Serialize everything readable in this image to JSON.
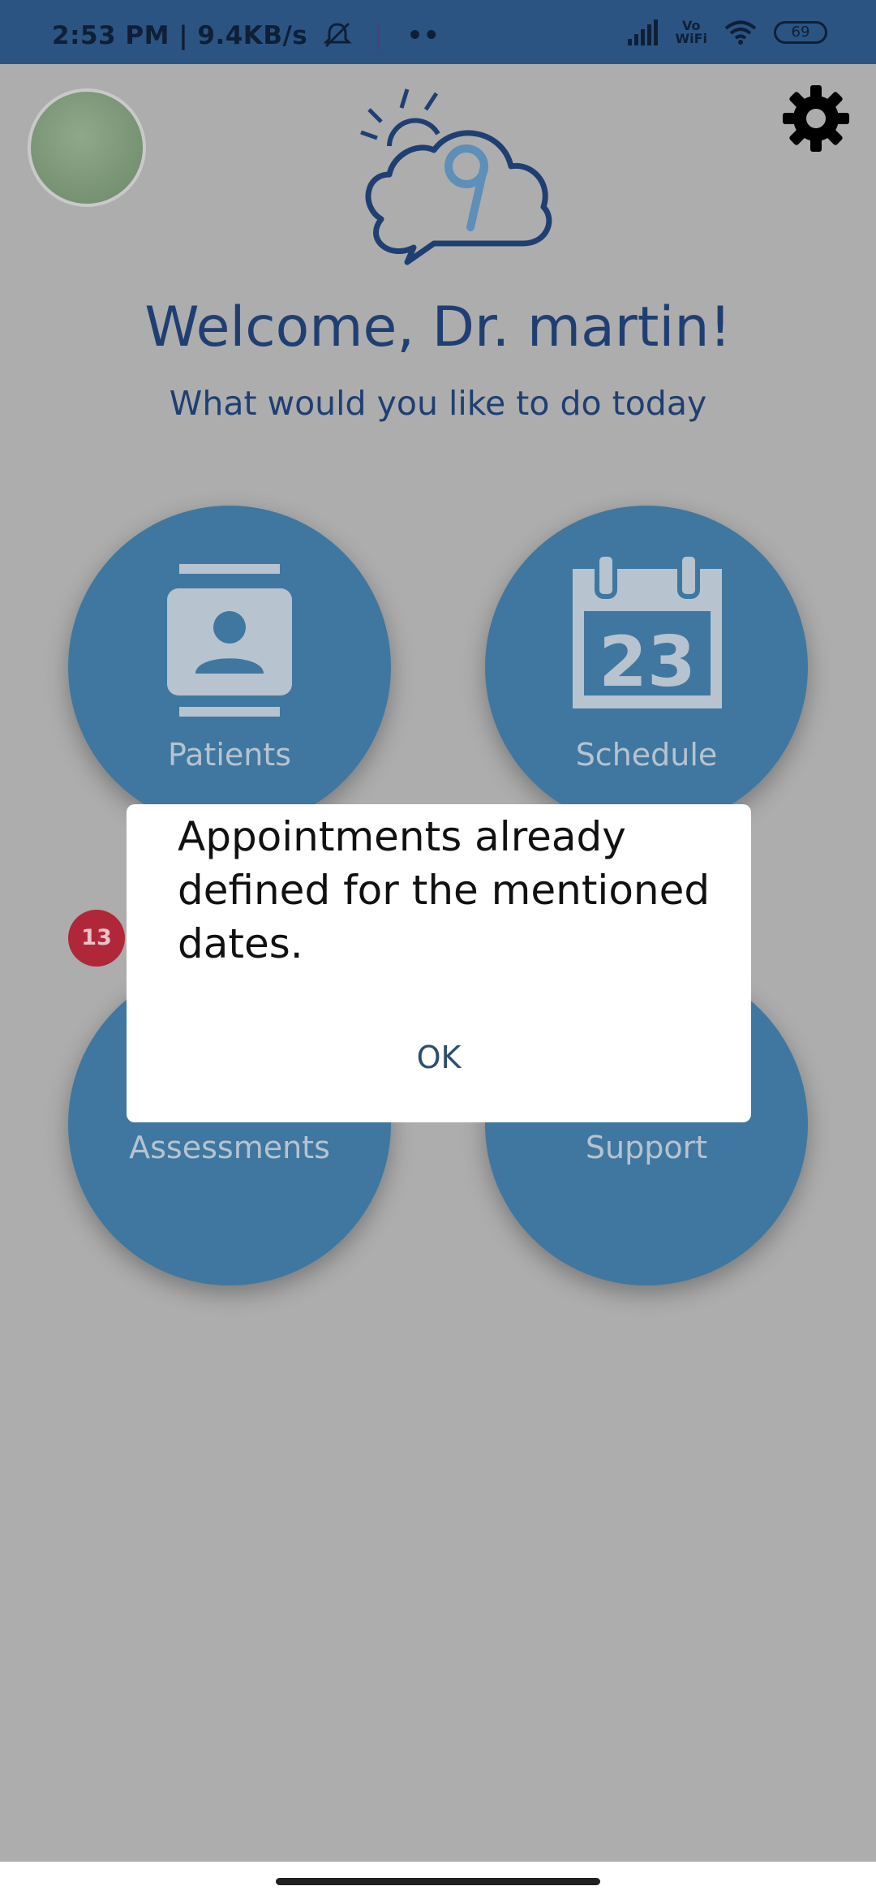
{
  "status_bar": {
    "time_speed": "2:53 PM | 9.4KB/s",
    "dots": "••",
    "vowifi_top": "Vo",
    "vowifi_bottom": "WiFi",
    "battery": "69",
    "icons": [
      "mute-icon",
      "signal-icon",
      "vowifi-icon",
      "wifi-icon",
      "battery-icon"
    ]
  },
  "header": {
    "welcome": "Welcome, Dr. martin!",
    "subtitle": "What would you like to do today",
    "logo_digit": "9"
  },
  "tiles": [
    {
      "label": "Patients",
      "icon": "contact-book-icon"
    },
    {
      "label": "Schedule",
      "icon": "calendar-icon",
      "icon_text": "23"
    },
    {
      "label": "Assessments",
      "icon": "assessments-icon",
      "badge": "13"
    },
    {
      "label": "Support",
      "icon": "support-icon"
    }
  ],
  "dialog": {
    "message": "Appointments already defined for the mentioned dates.",
    "ok_label": "OK"
  },
  "colors": {
    "status_bar": "#2b5483",
    "overlay_bg": "#adadad",
    "tile": "#3f77a0",
    "title_text": "#1f3f73",
    "badge": "#b1273a"
  }
}
